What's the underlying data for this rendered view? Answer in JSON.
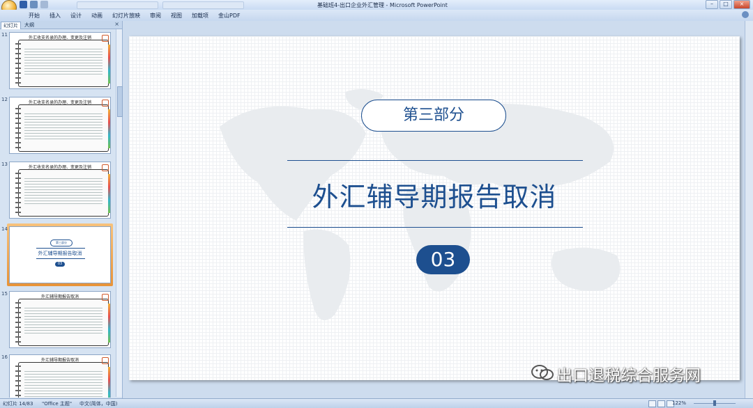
{
  "window": {
    "title": "基础班4-出口企业外汇管理 - Microsoft PowerPoint"
  },
  "ribbon": {
    "tabs": [
      "开始",
      "插入",
      "设计",
      "动画",
      "幻灯片放映",
      "审阅",
      "视图",
      "加载项",
      "金山PDF"
    ]
  },
  "pane": {
    "tabs": [
      "幻灯片",
      "大纲"
    ],
    "close": "×",
    "thumbnails": [
      {
        "number": "11",
        "title": "外汇收支名录的办理、变更及注销",
        "kind": "note"
      },
      {
        "number": "12",
        "title": "外汇收支名录的办理、变更及注销",
        "kind": "note"
      },
      {
        "number": "13",
        "title": "外汇收支名录的办理、变更及注销",
        "kind": "note"
      },
      {
        "number": "14",
        "title": "",
        "kind": "section",
        "pill": "第三部分",
        "section_title": "外汇辅导期报告取消",
        "section_num": "03"
      },
      {
        "number": "15",
        "title": "外汇辅导期报告取消",
        "kind": "note"
      },
      {
        "number": "16",
        "title": "外汇辅导期报告取消",
        "kind": "note"
      }
    ]
  },
  "slide": {
    "section_label": "第三部分",
    "title": "外汇辅导期报告取消",
    "section_number": "03",
    "watermark": "出口退税综合服务网"
  },
  "status": {
    "slide_info": "幻灯片 14/83",
    "theme": "\"Office 主题\"",
    "language": "中文(简体，中国)",
    "zoom": "122%"
  },
  "colors": {
    "accent": "#1d4f8f",
    "selection": "#e89338"
  }
}
